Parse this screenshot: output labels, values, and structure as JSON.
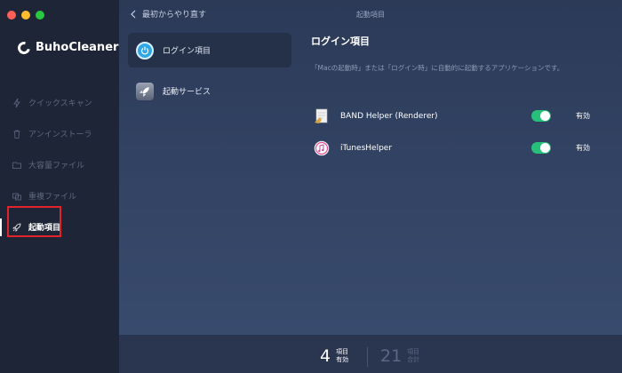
{
  "app": {
    "name": "BuhoCleaner"
  },
  "sidebar": {
    "items": [
      {
        "label": "クイックスキャン",
        "icon": "lightning-icon"
      },
      {
        "label": "アンインストーラ",
        "icon": "trash-icon"
      },
      {
        "label": "大容量ファイル",
        "icon": "folder-icon"
      },
      {
        "label": "重複ファイル",
        "icon": "duplicate-icon"
      },
      {
        "label": "起動項目",
        "icon": "rocket-icon",
        "active": true
      }
    ]
  },
  "header": {
    "back_label": "最初からやり直す",
    "title": "起動項目"
  },
  "categories": [
    {
      "label": "ログイン項目",
      "icon": "power-icon",
      "selected": true
    },
    {
      "label": "起動サービス",
      "icon": "rocket-icon"
    }
  ],
  "content": {
    "title": "ログイン項目",
    "description": "「Macの起動時」または「ログイン時」に自動的に起動するアプリケーションです。",
    "items": [
      {
        "name": "BAND Helper (Renderer)",
        "status": "有効",
        "enabled": true,
        "icon": "app-document-icon"
      },
      {
        "name": "iTunesHelper",
        "status": "有効",
        "enabled": true,
        "icon": "itunes-icon"
      }
    ]
  },
  "footer": {
    "enabled_count": "4",
    "enabled_label_1": "項目",
    "enabled_label_2": "有効",
    "total_count": "21",
    "total_label_1": "項目",
    "total_label_2": "合計"
  },
  "colors": {
    "accent_toggle": "#27c07a",
    "highlight": "#e2242a",
    "sidebar_bg": "#1e2536",
    "main_bg": "#2c3a58"
  }
}
